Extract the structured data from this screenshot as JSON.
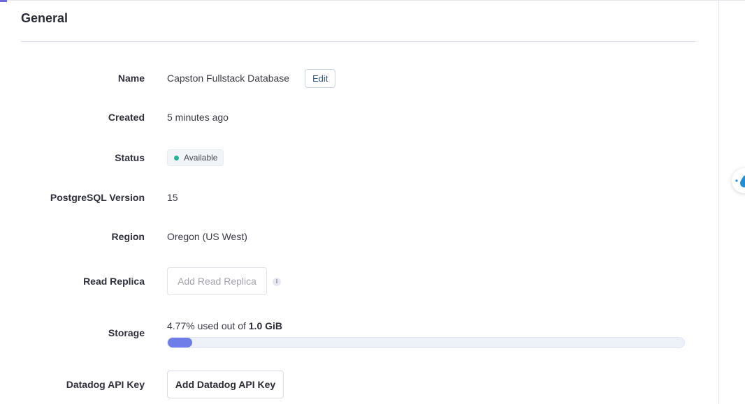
{
  "section": {
    "title": "General"
  },
  "fields": {
    "name": {
      "label": "Name",
      "value": "Capston Fullstack Database",
      "edit_label": "Edit"
    },
    "created": {
      "label": "Created",
      "value": "5 minutes ago"
    },
    "status": {
      "label": "Status",
      "value": "Available",
      "color": "#22b39a"
    },
    "postgres_version": {
      "label": "PostgreSQL Version",
      "value": "15"
    },
    "region": {
      "label": "Region",
      "value": "Oregon (US West)"
    },
    "read_replica": {
      "label": "Read Replica",
      "button_label": "Add Read Replica",
      "info_icon": "info-icon"
    },
    "storage": {
      "label": "Storage",
      "used_percent_text": "4.77%",
      "used_text": "used out of",
      "capacity_text": "1.0 GiB",
      "used_percent": 4.77,
      "bar_color": "#6e7de8"
    },
    "datadog": {
      "label": "Datadog API Key",
      "button_label": "Add Datadog API Key"
    }
  },
  "floating_widget": {
    "icon": "water-drop-icon"
  },
  "accent_color": "#6b6bd6"
}
